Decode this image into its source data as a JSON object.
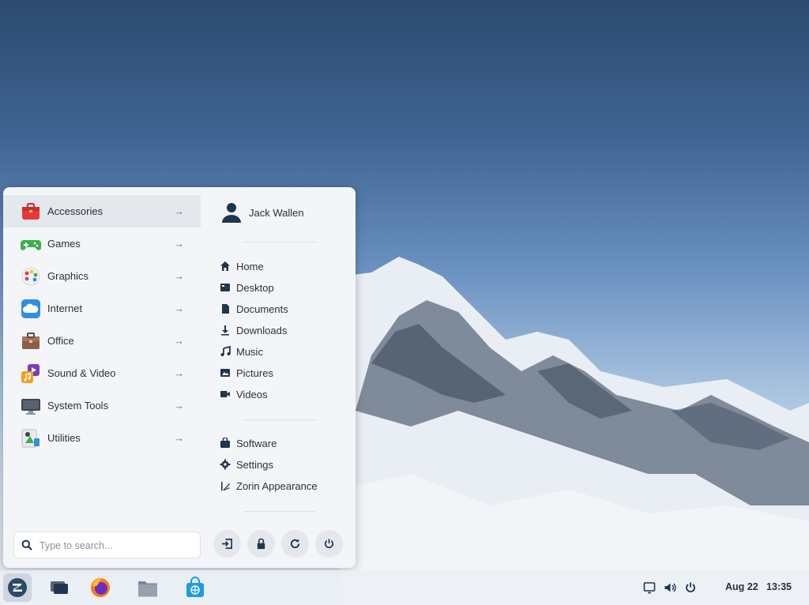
{
  "categories": [
    {
      "label": "Accessories",
      "icon": "toolbox-icon",
      "active": true
    },
    {
      "label": "Games",
      "icon": "gamepad-icon"
    },
    {
      "label": "Graphics",
      "icon": "palette-icon"
    },
    {
      "label": "Internet",
      "icon": "cloud-icon"
    },
    {
      "label": "Office",
      "icon": "briefcase-icon"
    },
    {
      "label": "Sound & Video",
      "icon": "media-icon"
    },
    {
      "label": "System Tools",
      "icon": "monitor-icon"
    },
    {
      "label": "Utilities",
      "icon": "utilities-icon"
    }
  ],
  "arrow_glyph": "→",
  "user": {
    "name": "Jack Wallen"
  },
  "places": [
    {
      "label": "Home",
      "icon": "home-icon"
    },
    {
      "label": "Desktop",
      "icon": "desktop-icon"
    },
    {
      "label": "Documents",
      "icon": "document-icon"
    },
    {
      "label": "Downloads",
      "icon": "download-icon"
    },
    {
      "label": "Music",
      "icon": "music-icon"
    },
    {
      "label": "Pictures",
      "icon": "picture-icon"
    },
    {
      "label": "Videos",
      "icon": "video-icon"
    }
  ],
  "system_items": [
    {
      "label": "Software",
      "icon": "software-bag-icon"
    },
    {
      "label": "Settings",
      "icon": "gear-icon"
    },
    {
      "label": "Zorin Appearance",
      "icon": "appearance-icon"
    }
  ],
  "search": {
    "placeholder": "Type to search..."
  },
  "power_buttons": [
    "logout-icon",
    "lock-icon",
    "restart-icon",
    "power-icon"
  ],
  "taskbar": {
    "apps": [
      "zorin-menu-icon",
      "workspaces-icon",
      "firefox-icon",
      "files-icon",
      "software-store-icon"
    ],
    "tray": [
      "display-icon",
      "volume-icon",
      "power-icon"
    ],
    "date": "Aug 22",
    "time": "13:35"
  },
  "colors": {
    "accent": "#2b4a66",
    "menu_bg": "#f3f5f8",
    "active_row": "#e4e7ec"
  }
}
